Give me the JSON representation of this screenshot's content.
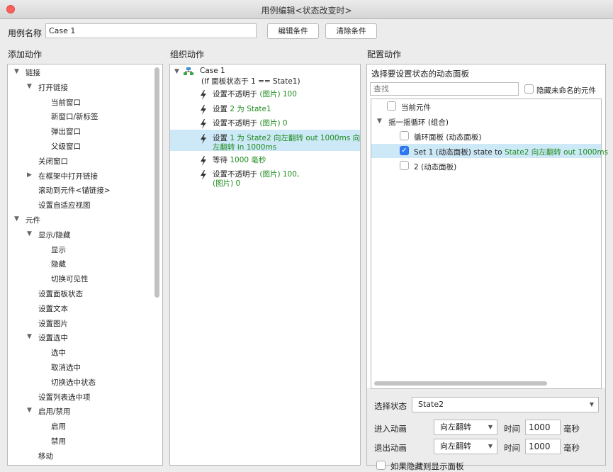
{
  "window": {
    "title": "用例编辑<状态改变时>"
  },
  "header": {
    "case_name_label": "用例名称",
    "case_name_value": "Case 1",
    "edit_conditions": "编辑条件",
    "clear_conditions": "清除条件"
  },
  "sections": {
    "add_actions": "添加动作",
    "organize_actions": "组织动作",
    "configure_actions": "配置动作"
  },
  "left_tree": [
    "链接",
    "打开链接",
    "当前窗口",
    "新窗口/新标签",
    "弹出窗口",
    "父级窗口",
    "关闭窗口",
    "在框架中打开链接",
    "滚动到元件<锚链接>",
    "设置自适应视图",
    "元件",
    "显示/隐藏",
    "显示",
    "隐藏",
    "切换可见性",
    "设置面板状态",
    "设置文本",
    "设置图片",
    "设置选中",
    "选中",
    "取消选中",
    "切换选中状态",
    "设置列表选中项",
    "启用/禁用",
    "启用",
    "禁用",
    "移动"
  ],
  "middle": {
    "case_title": "Case 1",
    "case_condition": "(If 面板状态于 1 == State1)",
    "actions": [
      {
        "prefix": "设置不透明于 ",
        "green": "(图片) 100"
      },
      {
        "prefix": "设置 ",
        "green": "2 为 State1"
      },
      {
        "prefix": "设置不透明于 ",
        "green": "(图片) 0"
      },
      {
        "prefix": "设置 ",
        "green": "1 为 State2 向左翻转 out 1000ms 向",
        "line2": "左翻转 in 1000ms"
      },
      {
        "prefix": "等待 ",
        "green": "1000 毫秒"
      },
      {
        "prefix": "设置不透明于 ",
        "green": "(图片) 100,",
        "line2": "(图片) 0"
      }
    ]
  },
  "right": {
    "subtitle": "选择要设置状态的动态面板",
    "search_placeholder": "查找",
    "hide_unnamed": "隐藏未命名的元件",
    "tree": {
      "current": "当前元件",
      "group": "摇一摇循环 (组合)",
      "loop_panel": "循环面板 (动态面板)",
      "set1_prefix": "Set 1 (动态面板) state to ",
      "set1_green": "State2 向左翻转 out 1000ms",
      "panel2": "2 (动态面板)"
    },
    "select_state_label": "选择状态",
    "select_state_value": "State2",
    "enter_anim_label": "进入动画",
    "enter_anim_value": "向左翻转",
    "exit_anim_label": "退出动画",
    "exit_anim_value": "向左翻转",
    "time_label": "时间",
    "enter_time": "1000",
    "exit_time": "1000",
    "ms_unit": "毫秒",
    "show_if_hidden": "如果隐藏则显示面板"
  }
}
